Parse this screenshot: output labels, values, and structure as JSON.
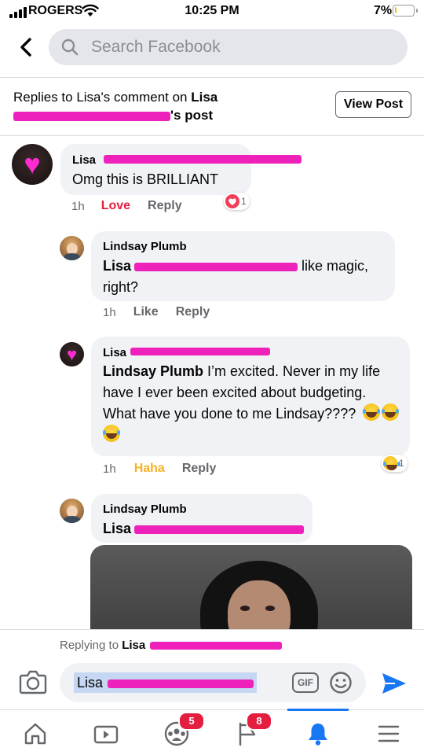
{
  "status_bar": {
    "carrier": "ROGERS",
    "time": "10:25 PM",
    "battery_pct": "7%",
    "battery_level": 0.07
  },
  "header": {
    "search_placeholder": "Search Facebook",
    "back_icon": "chevron-left-icon",
    "search_icon": "search-icon"
  },
  "banner": {
    "prefix": "Replies to Lisa's comment on ",
    "owner_first": "Lisa",
    "owner_suffix": "'s post",
    "view_post_label": "View Post"
  },
  "comments": [
    {
      "author": "Lisa",
      "text": "Omg this is BRILLIANT",
      "age": "1h",
      "reacted_label": "Love",
      "reply_label": "Reply",
      "reaction_count": "1",
      "reaction_icon": "heart-reaction-icon"
    },
    {
      "author": "Lindsay Plumb",
      "mention_first": "Lisa",
      "text_after_mention": " like magic, right?",
      "age": "1h",
      "like_label": "Like",
      "reply_label": "Reply"
    },
    {
      "author": "Lisa",
      "mention": "Lindsay Plumb",
      "text_after_mention": " I’m excited. Never in my life have I ever been excited about budgeting. What have you done to me Lindsay????",
      "age": "1h",
      "reacted_label": "Haha",
      "reply_label": "Reply",
      "reaction_count": "1",
      "reaction_icon": "laughing-reaction-icon"
    },
    {
      "author": "Lindsay Plumb",
      "mention_first": "Lisa"
    }
  ],
  "reply_bar": {
    "replying_prefix": "Replying to ",
    "replying_name": "Lisa",
    "compose_mention": "Lisa",
    "gif_label": "GIF"
  },
  "bottom_nav": {
    "items": [
      "home-icon",
      "watch-icon",
      "groups-icon",
      "pages-icon",
      "notifications-icon",
      "menu-icon"
    ],
    "groups_badge": "5",
    "pages_badge": "8",
    "active": "notifications-icon"
  },
  "colors": {
    "accent": "#1877f2",
    "love": "#e41e3f",
    "haha": "#f7b125",
    "bubble": "#f0f2f5",
    "redaction": "#ee22bb"
  }
}
